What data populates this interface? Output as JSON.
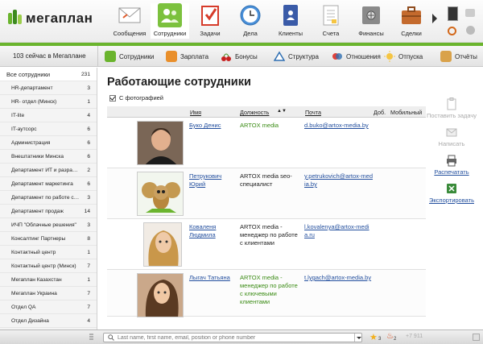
{
  "app": {
    "logo_text": "мегаплан"
  },
  "modules": [
    {
      "label": "Сообщения",
      "icon": "envelope-icon"
    },
    {
      "label": "Сотрудники",
      "icon": "people-icon",
      "active": true
    },
    {
      "label": "Задачи",
      "icon": "task-checklist-icon"
    },
    {
      "label": "Дела",
      "icon": "clock-icon"
    },
    {
      "label": "Клиенты",
      "icon": "address-book-icon"
    },
    {
      "label": "Счета",
      "icon": "invoice-icon"
    },
    {
      "label": "Финансы",
      "icon": "safe-icon"
    },
    {
      "label": "Сделки",
      "icon": "briefcase-icon"
    }
  ],
  "subnav": {
    "now_online": "103 сейчас в Мегаплане",
    "items": [
      {
        "label": "Сотрудники",
        "icon": "people-icon"
      },
      {
        "label": "Зарплата",
        "icon": "wallet-icon"
      },
      {
        "label": "Бонусы",
        "icon": "cherry-icon"
      },
      {
        "label": "Структура",
        "icon": "triangle-icon"
      },
      {
        "label": "Отношения",
        "icon": "relations-icon"
      },
      {
        "label": "Отпуска",
        "icon": "sun-icon"
      },
      {
        "label": "Отчёты",
        "icon": "report-icon"
      }
    ]
  },
  "sidebar": {
    "items": [
      {
        "label": "Все сотрудники",
        "count": "231",
        "selected": true
      },
      {
        "label": "HR-департамент",
        "count": "3"
      },
      {
        "label": "HR- отдел (Минск)",
        "count": "1"
      },
      {
        "label": "IT-lite",
        "count": "4"
      },
      {
        "label": "IT-аутсорс",
        "count": "6"
      },
      {
        "label": "Администрация",
        "count": "6"
      },
      {
        "label": "Внештатники Минска",
        "count": "6"
      },
      {
        "label": "Департамент ИТ и разра…",
        "count": "2"
      },
      {
        "label": "Департамент маркетинга",
        "count": "6"
      },
      {
        "label": "Департамент по работе с…",
        "count": "3"
      },
      {
        "label": "Департамент продаж",
        "count": "14"
      },
      {
        "label": "ИЧП \"Облачные решения\"",
        "count": "3"
      },
      {
        "label": "Консалтинг Партнеры",
        "count": "8"
      },
      {
        "label": "Контактный центр",
        "count": "1"
      },
      {
        "label": "Контактный центр (Минск)",
        "count": "7"
      },
      {
        "label": "Мегаплан Казахстан",
        "count": "1"
      },
      {
        "label": "Мегаплан Украина",
        "count": "7"
      },
      {
        "label": "Отдел QA",
        "count": "7"
      },
      {
        "label": "Отдел Дизайна",
        "count": "4"
      }
    ]
  },
  "main": {
    "title": "Работающие сотрудники",
    "with_photos_label": "С фотографией",
    "columns": {
      "name": "Имя",
      "position": "Должность",
      "email": "Почта",
      "ext": "Доб.",
      "mobile": "Мобильный"
    },
    "rows": [
      {
        "name": "Буко Денис",
        "position": "ARTOX media",
        "position_company_only": true,
        "email": "d.buko@artox-media.by"
      },
      {
        "name": "Петрукович Юрий",
        "position": "ARTOX media seo-специалист",
        "position_company_only": false,
        "email": "y.petrukovich@artox-media.by"
      },
      {
        "name": "Коваленя Людмила",
        "position": "ARTOX media - менеджер по работе с клиентами",
        "position_company_only": false,
        "email": "l.kovalenya@artox-media.ru"
      },
      {
        "name": "Лыгач Татьяна",
        "position": "ARTOX media - менеджер по работе с ключевыми клиентами",
        "position_company_only": false,
        "email": "t.lygach@artox-media.by"
      }
    ]
  },
  "tools": [
    {
      "label": "Поставить задачу",
      "icon": "task-add-icon",
      "disabled": true
    },
    {
      "label": "Написать",
      "icon": "envelope-icon",
      "disabled": true
    },
    {
      "label": "Распечатать",
      "icon": "printer-icon",
      "disabled": false
    },
    {
      "label": "Экспортировать",
      "icon": "export-icon",
      "disabled": false
    }
  ],
  "bottombar": {
    "search_placeholder": "Last name, first name, email, position or phone number",
    "stars_count": "3",
    "fire_count": "2",
    "phone_prefix": "+7 911"
  }
}
